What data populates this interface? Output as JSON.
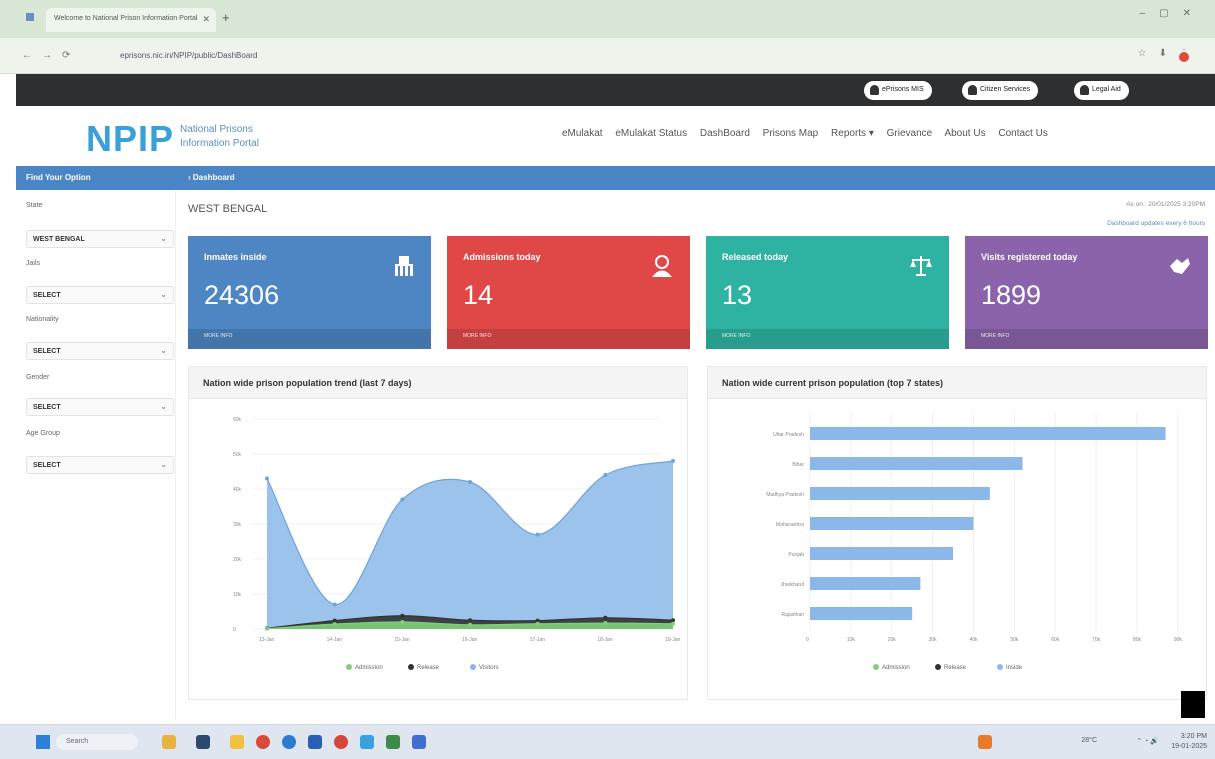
{
  "browser": {
    "tab_title": "Welcome to National Prison Information Portal",
    "url": "eprisons.nic.in/NPIP/public/DashBoard"
  },
  "header": {
    "buttons": [
      "ePrisons MIS",
      "Citizen Services",
      "Legal Aid"
    ],
    "logo": "NPIP",
    "logo_sub1": "National Prisons",
    "logo_sub2": "Information Portal",
    "nav": [
      "eMulakat",
      "eMulakat Status",
      "DashBoard",
      "Prisons Map",
      "Reports ▾",
      "Grievance",
      "About Us",
      "Contact Us"
    ]
  },
  "bluebar": {
    "left": "Find Your Option",
    "crumb": "› Dashboard"
  },
  "sidebar": {
    "fields": [
      {
        "label": "State",
        "value": "WEST BENGAL"
      },
      {
        "label": "Jails",
        "value": "SELECT"
      },
      {
        "label": "Nationality",
        "value": "SELECT"
      },
      {
        "label": "Gender",
        "value": "SELECT"
      },
      {
        "label": "Age Group",
        "value": "SELECT"
      }
    ]
  },
  "content": {
    "state_title": "WEST BENGAL",
    "as_on": "As on : 20/01/2025 3:20PM",
    "update_note": "Dashboard updates every 6 hours"
  },
  "cards": [
    {
      "title": "Inmates inside",
      "value": "24306",
      "more": "MORE INFO",
      "color": "#4d86c3",
      "icon": "prison-icon"
    },
    {
      "title": "Admissions today",
      "value": "14",
      "more": "MORE INFO",
      "color": "#e04848",
      "icon": "person-icon"
    },
    {
      "title": "Released today",
      "value": "13",
      "more": "MORE INFO",
      "color": "#2eb3a2",
      "icon": "scales-icon"
    },
    {
      "title": "Visits registered today",
      "value": "1899",
      "more": "MORE INFO",
      "color": "#8a63aa",
      "icon": "handshake-icon"
    }
  ],
  "panels": {
    "trend_title": "Nation wide prison population trend (last 7 days)",
    "top_title": "Nation wide current prison population (top 7 states)"
  },
  "chart_data": [
    {
      "type": "area",
      "title": "Nation wide prison population trend (last 7 days)",
      "x": [
        "13-Jan",
        "14-Jan",
        "15-Jan",
        "16-Jan",
        "17-Jan",
        "18-Jan",
        "19-Jan"
      ],
      "ylim": [
        0,
        600
      ],
      "yticks": [
        "0",
        "10k",
        "20k",
        "30k",
        "40k",
        "50k",
        "60k"
      ],
      "series": [
        {
          "name": "Admission",
          "values": [
            1,
            14,
            20,
            12,
            15,
            17,
            15
          ]
        },
        {
          "name": "Release",
          "values": [
            2,
            24,
            38,
            25,
            24,
            32,
            25
          ]
        },
        {
          "name": "Visitors",
          "values": [
            430,
            70,
            370,
            420,
            270,
            440,
            480
          ]
        }
      ],
      "colors": {
        "Admission": "#7fd27a",
        "Release": "#333333",
        "Visitors": "#8bb8e8"
      }
    },
    {
      "type": "bar",
      "title": "Nation wide current prison population (top 7 states)",
      "categories": [
        "Uttar Pradesh",
        "Bihar",
        "Madhya Pradesh",
        "Maharashtra",
        "Punjab",
        "Jharkhand",
        "Rajasthan"
      ],
      "values": [
        87,
        52,
        44,
        40,
        35,
        27,
        25
      ],
      "xlim": [
        0,
        92
      ],
      "xticks": [
        "0",
        "10k",
        "20k",
        "30k",
        "40k",
        "50k",
        "60k",
        "70k",
        "80k",
        "90k"
      ],
      "series_names": [
        "Admission",
        "Release",
        "Inside"
      ],
      "colors": {
        "Admission": "#7fd27a",
        "Release": "#333333",
        "Inside": "#8bb8e8"
      }
    }
  ],
  "taskbar": {
    "search": "Search",
    "tray_time": "3:20 PM",
    "tray_date": "19-01-2025",
    "weather": "28°C"
  }
}
